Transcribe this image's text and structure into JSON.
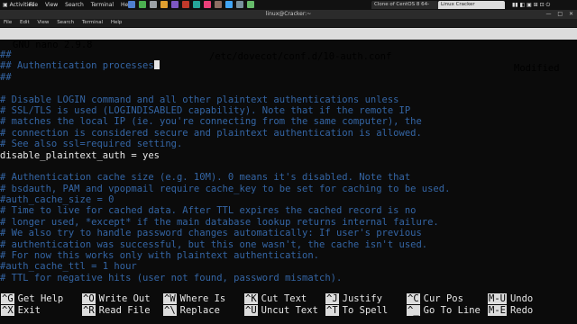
{
  "topbar": {
    "activities": "Activities",
    "menu": [
      "File",
      "View",
      "Search",
      "Terminal",
      "Help"
    ],
    "tabs": [
      "Clone of CentOS 8 64-bit",
      "Linux Cracker"
    ],
    "icon_colors": [
      "#4f7fcf",
      "#4caf50",
      "#9aa0a6",
      "#e0a030",
      "#7e57c2",
      "#c0392b",
      "#26a69a",
      "#ec407a",
      "#8d6e63",
      "#42a5f5",
      "#78909c",
      "#66bb6a"
    ]
  },
  "window": {
    "title": "linux@Cracker:~",
    "controls": [
      "—",
      "□",
      "✕"
    ]
  },
  "terminal_menu": [
    "File",
    "Edit",
    "View",
    "Search",
    "Terminal",
    "Help"
  ],
  "nano": {
    "version": "GNU nano 2.9.8",
    "filename": "/etc/dovecot/conf.d/10-auth.conf",
    "status": "Modified"
  },
  "lines": [
    {
      "text": "##",
      "type": "comment"
    },
    {
      "text": "## Authentication processes",
      "type": "comment",
      "cursor": true
    },
    {
      "text": "##",
      "type": "comment"
    },
    {
      "text": "",
      "type": "plain"
    },
    {
      "text": "# Disable LOGIN command and all other plaintext authentications unless",
      "type": "comment"
    },
    {
      "text": "# SSL/TLS is used (LOGINDISABLED capability). Note that if the remote IP",
      "type": "comment"
    },
    {
      "text": "# matches the local IP (ie. you're connecting from the same computer), the",
      "type": "comment"
    },
    {
      "text": "# connection is considered secure and plaintext authentication is allowed.",
      "type": "comment"
    },
    {
      "text": "# See also ssl=required setting.",
      "type": "comment"
    },
    {
      "text": "disable_plaintext_auth = yes",
      "type": "plain"
    },
    {
      "text": "",
      "type": "plain"
    },
    {
      "text": "# Authentication cache size (e.g. 10M). 0 means it's disabled. Note that",
      "type": "comment"
    },
    {
      "text": "# bsdauth, PAM and vpopmail require cache_key to be set for caching to be used.",
      "type": "comment"
    },
    {
      "text": "#auth_cache_size = 0",
      "type": "comment"
    },
    {
      "text": "# Time to live for cached data. After TTL expires the cached record is no",
      "type": "comment"
    },
    {
      "text": "# longer used, *except* if the main database lookup returns internal failure.",
      "type": "comment"
    },
    {
      "text": "# We also try to handle password changes automatically: If user's previous",
      "type": "comment"
    },
    {
      "text": "# authentication was successful, but this one wasn't, the cache isn't used.",
      "type": "comment"
    },
    {
      "text": "# For now this works only with plaintext authentication.",
      "type": "comment"
    },
    {
      "text": "#auth_cache_ttl = 1 hour",
      "type": "comment"
    },
    {
      "text": "# TTL for negative hits (user not found, password mismatch).",
      "type": "comment"
    }
  ],
  "shortcuts": [
    {
      "key": "^G",
      "label": "Get Help"
    },
    {
      "key": "^O",
      "label": "Write Out"
    },
    {
      "key": "^W",
      "label": "Where Is"
    },
    {
      "key": "^K",
      "label": "Cut Text"
    },
    {
      "key": "^J",
      "label": "Justify"
    },
    {
      "key": "^C",
      "label": "Cur Pos"
    },
    {
      "key": "M-U",
      "label": "Undo"
    },
    {
      "key": "^X",
      "label": "Exit"
    },
    {
      "key": "^R",
      "label": "Read File"
    },
    {
      "key": "^\\",
      "label": "Replace"
    },
    {
      "key": "^U",
      "label": "Uncut Text"
    },
    {
      "key": "^T",
      "label": "To Spell"
    },
    {
      "key": "^_",
      "label": "Go To Line"
    },
    {
      "key": "M-E",
      "label": "Redo"
    }
  ]
}
